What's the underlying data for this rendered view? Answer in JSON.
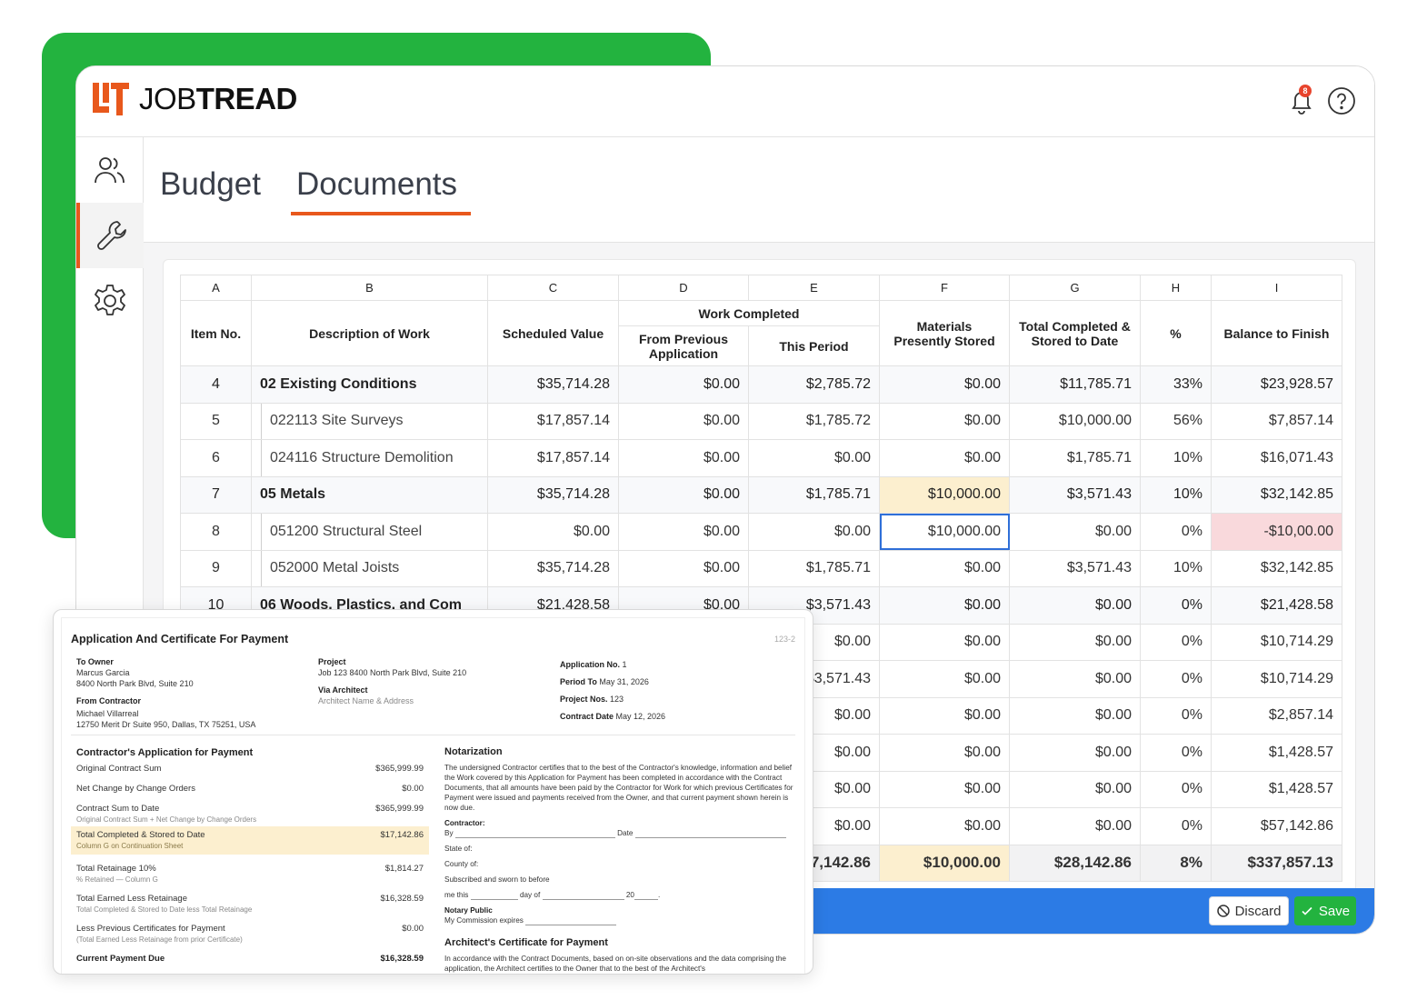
{
  "brand": {
    "name_light": "JOB",
    "name_bold": "TREAD",
    "notification_count": "8"
  },
  "tabs": [
    {
      "label": "Budget"
    },
    {
      "label": "Documents"
    }
  ],
  "grid": {
    "letters": [
      "A",
      "B",
      "C",
      "D",
      "E",
      "F",
      "G",
      "H",
      "I"
    ],
    "headers": {
      "item_no": "Item No.",
      "description": "Description of Work",
      "scheduled": "Scheduled Value",
      "work_completed": "Work Completed",
      "from_previous": "From Previous Application",
      "this_period": "This Period",
      "materials": "Materials Presently Stored",
      "total_completed": "Total Completed & Stored to Date",
      "percent": "%",
      "balance": "Balance to Finish"
    },
    "rows": [
      {
        "item": "4",
        "desc": "02 Existing Conditions",
        "sched": "$35,714.28",
        "prev": "$0.00",
        "period": "$2,785.72",
        "mat": "$0.00",
        "total": "$11,785.71",
        "pct": "33%",
        "bal": "$23,928.57"
      },
      {
        "item": "5",
        "desc": "022113 Site Surveys",
        "sched": "$17,857.14",
        "prev": "$0.00",
        "period": "$1,785.72",
        "mat": "$0.00",
        "total": "$10,000.00",
        "pct": "56%",
        "bal": "$7,857.14"
      },
      {
        "item": "6",
        "desc": "024116 Structure Demolition",
        "sched": "$17,857.14",
        "prev": "$0.00",
        "period": "$0.00",
        "mat": "$0.00",
        "total": "$1,785.71",
        "pct": "10%",
        "bal": "$16,071.43"
      },
      {
        "item": "7",
        "desc": "05 Metals",
        "sched": "$35,714.28",
        "prev": "$0.00",
        "period": "$1,785.71",
        "mat": "$10,000.00",
        "total": "$3,571.43",
        "pct": "10%",
        "bal": "$32,142.85"
      },
      {
        "item": "8",
        "desc": "051200 Structural Steel",
        "sched": "$0.00",
        "prev": "$0.00",
        "period": "$0.00",
        "mat": "$10,000.00",
        "total": "$0.00",
        "pct": "0%",
        "bal": "-$10,00.00"
      },
      {
        "item": "9",
        "desc": "052000 Metal Joists",
        "sched": "$35,714.28",
        "prev": "$0.00",
        "period": "$1,785.71",
        "mat": "$0.00",
        "total": "$3,571.43",
        "pct": "10%",
        "bal": "$32,142.85"
      },
      {
        "item": "10",
        "desc": "06 Woods, Plastics, and Com",
        "sched": "$21,428.58",
        "prev": "$0.00",
        "period": "$3,571.43",
        "mat": "$0.00",
        "total": "$0.00",
        "pct": "0%",
        "bal": "$21,428.58"
      },
      {
        "item": "",
        "desc": "",
        "sched": "",
        "prev": "",
        "period": "$0.00",
        "mat": "$0.00",
        "total": "$0.00",
        "pct": "0%",
        "bal": "$10,714.29"
      },
      {
        "item": "",
        "desc": "",
        "sched": "",
        "prev": "",
        "period": "$3,571.43",
        "mat": "$0.00",
        "total": "$0.00",
        "pct": "0%",
        "bal": "$10,714.29"
      },
      {
        "item": "",
        "desc": "",
        "sched": "",
        "prev": "",
        "period": "$0.00",
        "mat": "$0.00",
        "total": "$0.00",
        "pct": "0%",
        "bal": "$2,857.14"
      },
      {
        "item": "",
        "desc": "",
        "sched": "",
        "prev": "",
        "period": "$0.00",
        "mat": "$0.00",
        "total": "$0.00",
        "pct": "0%",
        "bal": "$1,428.57"
      },
      {
        "item": "",
        "desc": "",
        "sched": "",
        "prev": "",
        "period": "$0.00",
        "mat": "$0.00",
        "total": "$0.00",
        "pct": "0%",
        "bal": "$1,428.57"
      },
      {
        "item": "",
        "desc": "",
        "sched": "",
        "prev": "",
        "period": "$0.00",
        "mat": "$0.00",
        "total": "$0.00",
        "pct": "0%",
        "bal": "$57,142.86"
      }
    ],
    "totals": {
      "period": "$57,142.86",
      "mat": "$10,000.00",
      "total": "$28,142.86",
      "pct": "8%",
      "bal": "$337,857.13"
    }
  },
  "actions": {
    "discard": "Discard",
    "save": "Save"
  },
  "document": {
    "title": "Application And Certificate For Payment",
    "doc_no": "123-2",
    "to_owner_label": "To Owner",
    "owner_name": "Marcus Garcia",
    "owner_address": "8400 North Park Blvd, Suite 210",
    "from_contractor_label": "From Contractor",
    "contractor_name": "Michael Villarreal",
    "contractor_address": "12750 Merit Dr Suite 950, Dallas, TX 75251, USA",
    "project_label": "Project",
    "project_value": "Job 123 8400 North Park Blvd, Suite 210",
    "via_architect_label": "Via Architect",
    "architect_placeholder": "Architect Name & Address",
    "application_no_label": "Application No.",
    "application_no": "1",
    "period_to_label": "Period To",
    "period_to": "May 31, 2026",
    "project_nos_label": "Project Nos.",
    "project_nos": "123",
    "contract_date_label": "Contract Date",
    "contract_date": "May 12, 2026",
    "app_heading": "Contractor's Application for Payment",
    "lines": [
      {
        "label": "Original Contract Sum",
        "value": "$365,999.99",
        "sub": ""
      },
      {
        "label": "Net Change by Change Orders",
        "value": "$0.00",
        "sub": ""
      },
      {
        "label": "Contract Sum to Date",
        "value": "$365,999.99",
        "sub": "Original Contract Sum + Net Change by Change Orders"
      },
      {
        "label": "Total Completed & Stored to Date",
        "value": "$17,142.86",
        "sub": "Column G on Continuation Sheet"
      },
      {
        "label": "Total Retainage 10%",
        "value": "$1,814.27",
        "sub": "% Retained — Column G"
      },
      {
        "label": "Total Earned Less Retainage",
        "value": "$16,328.59",
        "sub": "Total Completed & Stored to Date less Total Retainage"
      },
      {
        "label": "Less Previous Certificates for Payment",
        "value": "$0.00",
        "sub": "(Total Earned Less Retainage from prior Certificate)"
      },
      {
        "label": "Current Payment Due",
        "value": "$16,328.59",
        "sub": ""
      }
    ],
    "notarization_heading": "Notarization",
    "notarization_text": "The undersigned Contractor certifies that to the best of the Contractor's knowledge, information and belief the Work covered by this Application for Payment has been completed in accordance with the Contract Documents, that all amounts have been paid by the Contractor for Work for which previous Certificates for Payment were issued and payments received from the Owner, and that current payment shown herein is now due.",
    "contractor_label": "Contractor:",
    "by_label": "By",
    "date_label": "Date",
    "state_label": "State of:",
    "county_label": "County of:",
    "sworn_label": "Subscribed and sworn to before",
    "me_this": "me this",
    "day_of": "day of",
    "year_prefix": "20",
    "notary_label": "Notary Public",
    "commission_label": "My Commission expires",
    "architect_heading": "Architect's Certificate for Payment",
    "architect_text": "In accordance with the Contract Documents, based on on-site observations and the data comprising the application, the Architect certifies to the Owner that to the best of the Architect's"
  }
}
